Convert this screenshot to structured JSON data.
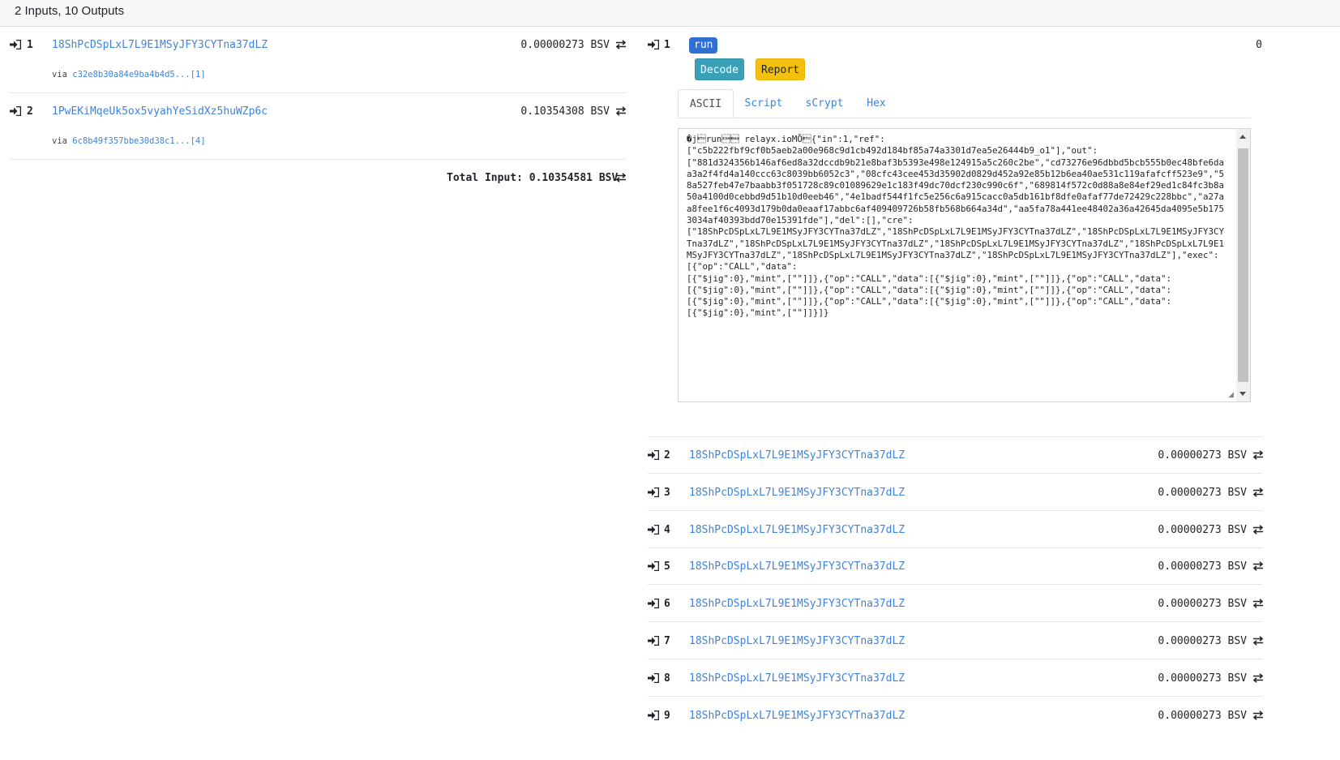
{
  "header": {
    "summary": "2 Inputs, 10 Outputs"
  },
  "inputs": [
    {
      "index": "1",
      "address": "18ShPcDSpLxL7L9E1MSyJFY3CYTna37dLZ",
      "amount": "0.00000273 BSV",
      "via_label": "via",
      "via_link": "c32e8b30a84e9ba4b4d5...[1]"
    },
    {
      "index": "2",
      "address": "1PwEKiMqeUk5ox5vyahYeSidXz5huWZp6c",
      "amount": "0.10354308 BSV",
      "via_label": "via",
      "via_link": "6c8b49f357bbe30d38c1...[4]"
    }
  ],
  "total_input": "Total Input: 0.10354581 BSV",
  "op_return_output": {
    "index": "1",
    "protocol_badge": "run",
    "amount": "0",
    "decode_label": "Decode",
    "report_label": "Report",
    "tabs": [
      "ASCII",
      "Script",
      "sCrypt",
      "Hex"
    ],
    "active_tab": "ASCII",
    "ascii_text": "�j\u0003run\u0001\u0005 relayx.ioMÕ\u0003{\"in\":1,\"ref\":\n[\"c5b222fbf9cf0b5aeb2a00e968c9d1cb492d184bf85a74a3301d7ea5e26444b9_o1\"],\"out\":\n[\"881d324356b146af6ed8a32dccdb9b21e8baf3b5393e498e124915a5c260c2be\",\"cd73276e96dbbd5bcb555b0ec48bfe6daa3a2f4fd4a140ccc63c8039bb6052c3\",\"08cfc43cee453d35902d0829d452a92e85b12b6ea40ae531c119afafcff523e9\",\"58a527feb47e7baabb3f051728c89c01089629e1c183f49dc70dcf230c990c6f\",\"689814f572c0d88a8e84ef29ed1c84fc3b8a50a4100d0cebbd9d51b10d0eeb46\",\"4e1badf544f1fc5e256c6a915cacc0a5db161bf8dfe0afaf77de72429c228bbc\",\"a27aa8fee1f6c4093d179b0da0eaaf17abbc6af409409726b58fb568b664a34d\",\"aa5fa78a441ee48402a36a42645da4095e5b1753034af40393bdd70e15391fde\"],\"del\":[],\"cre\":\n[\"18ShPcDSpLxL7L9E1MSyJFY3CYTna37dLZ\",\"18ShPcDSpLxL7L9E1MSyJFY3CYTna37dLZ\",\"18ShPcDSpLxL7L9E1MSyJFY3CYTna37dLZ\",\"18ShPcDSpLxL7L9E1MSyJFY3CYTna37dLZ\",\"18ShPcDSpLxL7L9E1MSyJFY3CYTna37dLZ\",\"18ShPcDSpLxL7L9E1MSyJFY3CYTna37dLZ\",\"18ShPcDSpLxL7L9E1MSyJFY3CYTna37dLZ\",\"18ShPcDSpLxL7L9E1MSyJFY3CYTna37dLZ\"],\"exec\":[{\"op\":\"CALL\",\"data\":\n[{\"$jig\":0},\"mint\",[\"\"]]},{\"op\":\"CALL\",\"data\":[{\"$jig\":0},\"mint\",[\"\"]]},{\"op\":\"CALL\",\"data\":\n[{\"$jig\":0},\"mint\",[\"\"]]},{\"op\":\"CALL\",\"data\":[{\"$jig\":0},\"mint\",[\"\"]]},{\"op\":\"CALL\",\"data\":\n[{\"$jig\":0},\"mint\",[\"\"]]},{\"op\":\"CALL\",\"data\":[{\"$jig\":0},\"mint\",[\"\"]]},{\"op\":\"CALL\",\"data\":\n[{\"$jig\":0},\"mint\",[\"\"]]}]}"
  },
  "outputs": [
    {
      "index": "2",
      "address": "18ShPcDSpLxL7L9E1MSyJFY3CYTna37dLZ",
      "amount": "0.00000273 BSV"
    },
    {
      "index": "3",
      "address": "18ShPcDSpLxL7L9E1MSyJFY3CYTna37dLZ",
      "amount": "0.00000273 BSV"
    },
    {
      "index": "4",
      "address": "18ShPcDSpLxL7L9E1MSyJFY3CYTna37dLZ",
      "amount": "0.00000273 BSV"
    },
    {
      "index": "5",
      "address": "18ShPcDSpLxL7L9E1MSyJFY3CYTna37dLZ",
      "amount": "0.00000273 BSV"
    },
    {
      "index": "6",
      "address": "18ShPcDSpLxL7L9E1MSyJFY3CYTna37dLZ",
      "amount": "0.00000273 BSV"
    },
    {
      "index": "7",
      "address": "18ShPcDSpLxL7L9E1MSyJFY3CYTna37dLZ",
      "amount": "0.00000273 BSV"
    },
    {
      "index": "8",
      "address": "18ShPcDSpLxL7L9E1MSyJFY3CYTna37dLZ",
      "amount": "0.00000273 BSV"
    },
    {
      "index": "9",
      "address": "18ShPcDSpLxL7L9E1MSyJFY3CYTna37dLZ",
      "amount": "0.00000273 BSV"
    }
  ],
  "icons": {
    "input_arrow": "sign-in-icon",
    "transfer": "exchange-icon"
  },
  "colors": {
    "link": "#3f83d8",
    "badge": "#2f6fd0",
    "decode": "#3aa0b8",
    "report": "#f3c00f"
  }
}
